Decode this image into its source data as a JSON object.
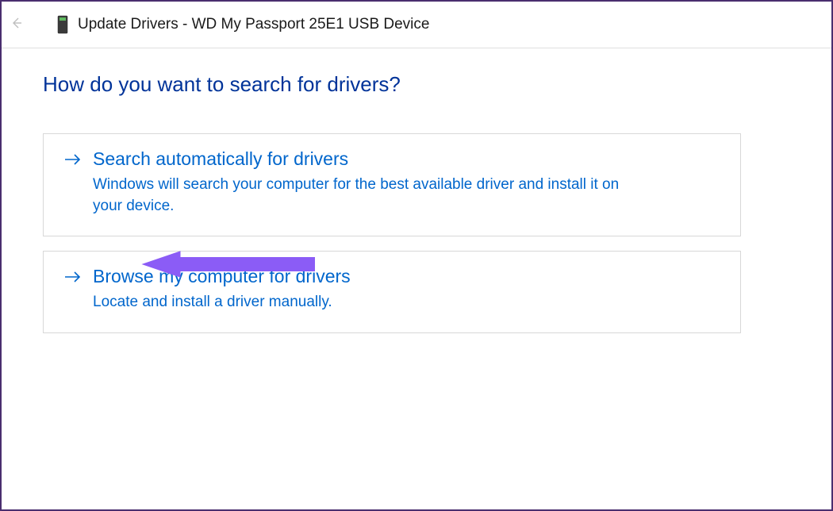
{
  "header": {
    "title": "Update Drivers - WD My Passport 25E1 USB Device"
  },
  "main": {
    "heading": "How do you want to search for drivers?",
    "options": [
      {
        "title": "Search automatically for drivers",
        "description": "Windows will search your computer for the best available driver and install it on your device."
      },
      {
        "title": "Browse my computer for drivers",
        "description": "Locate and install a driver manually."
      }
    ]
  }
}
